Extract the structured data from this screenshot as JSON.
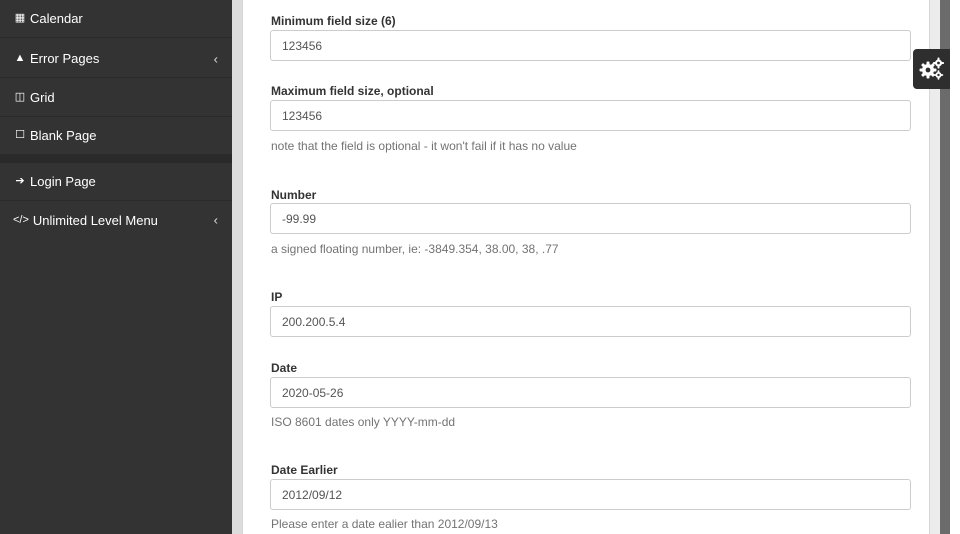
{
  "sidebar": {
    "items": [
      {
        "label": "Calendar",
        "icon": "calendar-icon",
        "glyph": "▦"
      },
      {
        "label": "Error Pages",
        "icon": "warning-icon",
        "glyph": "▲",
        "chevron": "‹"
      },
      {
        "label": "Grid",
        "icon": "columns-icon",
        "glyph": "◫"
      },
      {
        "label": "Blank Page",
        "icon": "square-icon",
        "glyph": "☐"
      },
      {
        "label": "Login Page",
        "icon": "sign-in-icon",
        "glyph": "➔"
      },
      {
        "label": "Unlimited Level Menu",
        "icon": "code-icon",
        "glyph": "</>",
        "chevron": "‹"
      }
    ]
  },
  "form": {
    "min": {
      "label": "Minimum field size (6)",
      "value": "123456"
    },
    "max": {
      "label": "Maximum field size, optional",
      "value": "123456",
      "help": "note that the field is optional - it won't fail if it has no value"
    },
    "number": {
      "label": "Number",
      "value": "-99.99",
      "help": "a signed floating number, ie: -3849.354, 38.00, 38, .77"
    },
    "ip": {
      "label": "IP",
      "value": "200.200.5.4"
    },
    "date": {
      "label": "Date",
      "value": "2020-05-26",
      "help": "ISO 8601 dates only YYYY-mm-dd"
    },
    "date_earlier": {
      "label": "Date Earlier",
      "value": "2012/09/12",
      "help": "Please enter a date ealier than 2012/09/13"
    }
  },
  "settings_button": {
    "icon": "gears-icon"
  }
}
